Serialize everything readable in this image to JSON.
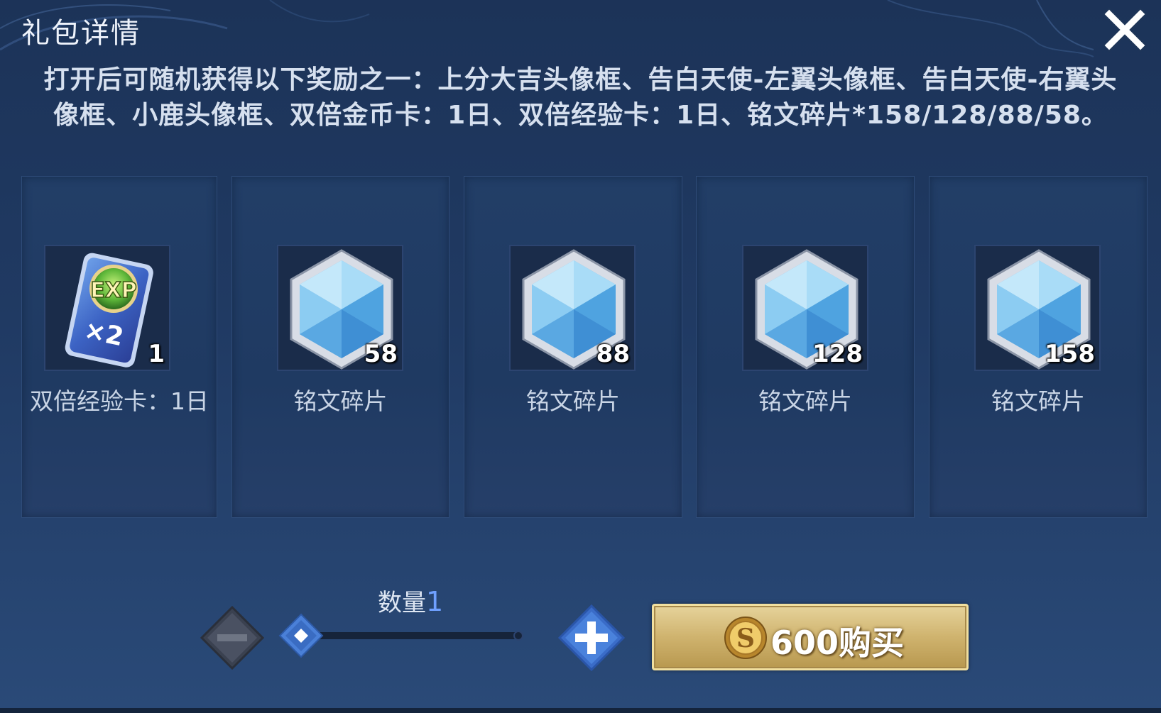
{
  "dialog": {
    "title": "礼包详情",
    "description": "打开后可随机获得以下奖励之一：上分大吉头像框、告白天使-左翼头像框、告白天使-右翼头像框、小鹿头像框、双倍金币卡：1日、双倍经验卡：1日、铭文碎片*158/128/88/58。",
    "close_icon": "close-icon"
  },
  "rewards": [
    {
      "name": "双倍经验卡：1日",
      "count": "1",
      "icon": "exp-card-icon",
      "card_text_top": "EXP",
      "card_text_bottom": "×2"
    },
    {
      "name": "铭文碎片",
      "count": "58",
      "icon": "inscription-shard-icon"
    },
    {
      "name": "铭文碎片",
      "count": "88",
      "icon": "inscription-shard-icon"
    },
    {
      "name": "铭文碎片",
      "count": "128",
      "icon": "inscription-shard-icon"
    },
    {
      "name": "铭文碎片",
      "count": "158",
      "icon": "inscription-shard-icon"
    }
  ],
  "quantity": {
    "label": "数量",
    "value": "1",
    "slider_fraction": 0,
    "minus_icon": "minus-icon",
    "plus_icon": "plus-icon"
  },
  "buy_button": {
    "label": "600购买",
    "currency_icon": "gold-coin-icon"
  },
  "colors": {
    "background": "#1f3a62",
    "accent_blue": "#6fa0ff",
    "buy_gold": "#cfb36e"
  }
}
